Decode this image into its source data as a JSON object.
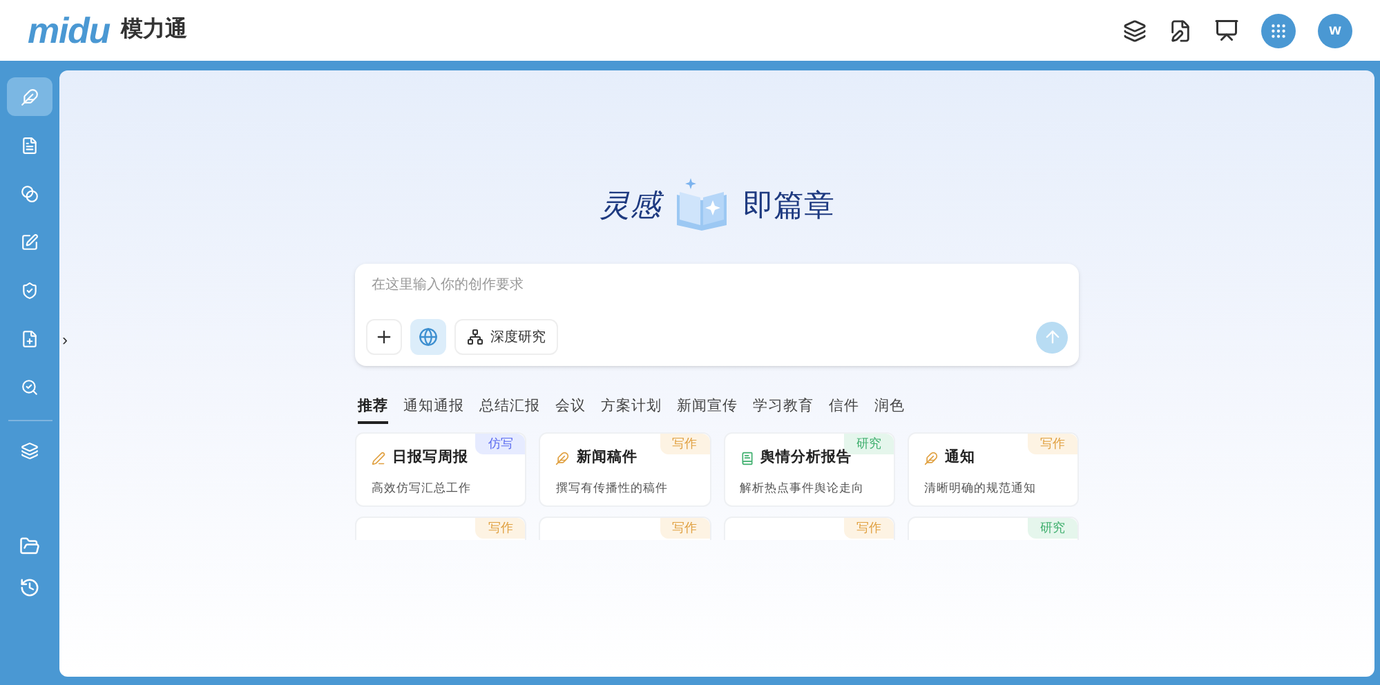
{
  "header": {
    "logo": "midu",
    "brand": "模力通",
    "avatar": "w"
  },
  "sidebar": {
    "items": [
      {
        "selected": true
      },
      {
        "selected": false
      },
      {
        "selected": false
      },
      {
        "selected": false
      },
      {
        "selected": false
      },
      {
        "selected": false
      },
      {
        "selected": false
      },
      {
        "selected": false
      }
    ],
    "collapse": "›"
  },
  "hero": {
    "left": "灵感",
    "right": "即篇章"
  },
  "composer": {
    "placeholder": "在这里输入你的创作要求",
    "web_search_on": true,
    "deep_research": "深度研究"
  },
  "tabs": [
    {
      "label": "推荐",
      "selected": true
    },
    {
      "label": "通知通报",
      "selected": false
    },
    {
      "label": "总结汇报",
      "selected": false
    },
    {
      "label": "会议",
      "selected": false
    },
    {
      "label": "方案计划",
      "selected": false
    },
    {
      "label": "新闻宣传",
      "selected": false
    },
    {
      "label": "学习教育",
      "selected": false
    },
    {
      "label": "信件",
      "selected": false
    },
    {
      "label": "润色",
      "selected": false
    }
  ],
  "cards": [
    {
      "title": "日报写周报",
      "desc": "高效仿写汇总工作",
      "tag": "仿写",
      "kind": "imitate"
    },
    {
      "title": "新闻稿件",
      "desc": "撰写有传播性的稿件",
      "tag": "写作",
      "kind": "write"
    },
    {
      "title": "舆情分析报告",
      "desc": "解析热点事件舆论走向",
      "tag": "研究",
      "kind": "research"
    },
    {
      "title": "通知",
      "desc": "清晰明确的规范通知",
      "tag": "写作",
      "kind": "write"
    },
    {
      "tag": "写作",
      "kind": "write"
    },
    {
      "tag": "写作",
      "kind": "write"
    },
    {
      "tag": "写作",
      "kind": "write"
    },
    {
      "tag": "研究",
      "kind": "research"
    }
  ]
}
